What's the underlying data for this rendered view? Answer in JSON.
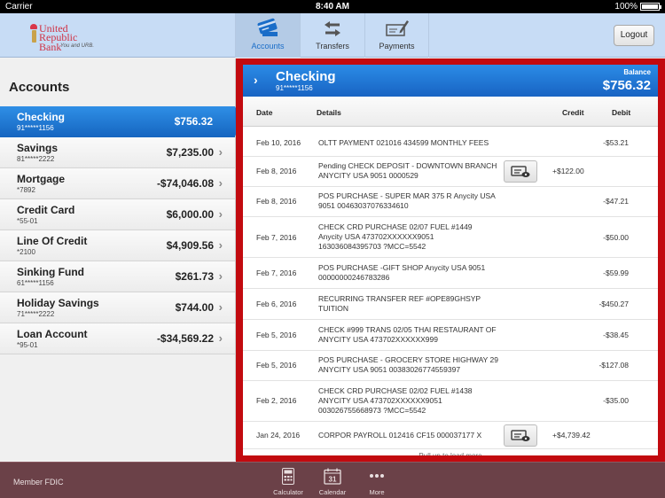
{
  "status_bar": {
    "carrier": "Carrier",
    "time": "8:40 AM",
    "battery": "100%"
  },
  "header": {
    "logo": {
      "line1": "United",
      "line2": "Republic Bank",
      "tagline": "You and URB."
    },
    "tabs": [
      {
        "label": "Accounts",
        "icon": "credit-card-icon",
        "active": true
      },
      {
        "label": "Transfers",
        "icon": "transfer-arrows-icon",
        "active": false
      },
      {
        "label": "Payments",
        "icon": "check-pen-icon",
        "active": false
      }
    ],
    "logout_label": "Logout"
  },
  "sidebar": {
    "title": "Accounts",
    "accounts": [
      {
        "name": "Checking",
        "number": "91*****1156",
        "balance": "$756.32",
        "selected": true
      },
      {
        "name": "Savings",
        "number": "81*****2222",
        "balance": "$7,235.00"
      },
      {
        "name": "Mortgage",
        "number": "*7892",
        "balance": "-$74,046.08"
      },
      {
        "name": "Credit Card",
        "number": "*55-01",
        "balance": "$6,000.00"
      },
      {
        "name": "Line Of Credit",
        "number": "*2100",
        "balance": "$4,909.56"
      },
      {
        "name": "Sinking Fund",
        "number": "61*****1156",
        "balance": "$261.73"
      },
      {
        "name": "Holiday Savings",
        "number": "71*****2222",
        "balance": "$744.00"
      },
      {
        "name": "Loan Account",
        "number": "*95-01",
        "balance": "-$34,569.22"
      }
    ]
  },
  "detail": {
    "account_name": "Checking",
    "account_number": "91*****1156",
    "balance_label": "Balance",
    "balance_value": "$756.32",
    "columns": {
      "date": "Date",
      "details": "Details",
      "credit": "Credit",
      "debit": "Debit"
    },
    "transactions": [
      {
        "date": "Feb 10, 2016",
        "details": "OLTT PAYMENT 021016 434599 MONTHLY FEES",
        "credit": "",
        "debit": "-$53.21",
        "has_image": false
      },
      {
        "date": "Feb 8, 2016",
        "details": "Pending CHECK DEPOSIT - DOWNTOWN BRANCH ANYCITY USA 9051 0000529",
        "credit": "+$122.00",
        "debit": "",
        "has_image": true
      },
      {
        "date": "Feb 8, 2016",
        "details": "POS PURCHASE -  SUPER MAR 375 R Anycity USA 9051 00463037076334610",
        "credit": "",
        "debit": "-$47.21",
        "has_image": false
      },
      {
        "date": "Feb 7, 2016",
        "details": "CHECK CRD PURCHASE 02/07  FUEL #1449 Anycity USA 473702XXXXXX9051 163036084395703 ?MCC=5542",
        "credit": "",
        "debit": "-$50.00",
        "has_image": false
      },
      {
        "date": "Feb 7, 2016",
        "details": "POS PURCHASE -GIFT SHOP Anycity USA 9051 00000000246783286",
        "credit": "",
        "debit": "-$59.99",
        "has_image": false
      },
      {
        "date": "Feb 6, 2016",
        "details": "RECURRING TRANSFER REF #OPE89GHSYP TUITION",
        "credit": "",
        "debit": "-$450.27",
        "has_image": false
      },
      {
        "date": "Feb 5, 2016",
        "details": "CHECK #999 TRANS 02/05 THAI RESTAURANT OF ANYCITY USA 473702XXXXXX999",
        "credit": "",
        "debit": "-$38.45",
        "has_image": false
      },
      {
        "date": "Feb 5, 2016",
        "details": "POS PURCHASE - GROCERY STORE HIGHWAY 29 ANYCITY USA 9051 00383026774559397",
        "credit": "",
        "debit": "-$127.08",
        "has_image": false
      },
      {
        "date": "Feb 2, 2016",
        "details": "CHECK CRD PURCHASE 02/02 FUEL #1438 ANYCITY USA 473702XXXXXX9051 003026755668973 ?MCC=5542",
        "credit": "",
        "debit": "-$35.00",
        "has_image": false
      },
      {
        "date": "Jan 24, 2016",
        "details": "CORPOR PAYROLL 012416 CF15 000037177 X",
        "credit": "+$4,739.42",
        "debit": "",
        "has_image": true
      }
    ],
    "load_more": "Pull up to load more"
  },
  "footer": {
    "fdic": "Member FDIC",
    "tools": [
      {
        "label": "Calculator",
        "icon": "calculator-icon"
      },
      {
        "label": "Calendar",
        "icon": "calendar-icon",
        "day": "31"
      },
      {
        "label": "More",
        "icon": "more-dots-icon"
      }
    ]
  },
  "colors": {
    "brand_red": "#c20a0f",
    "accent_blue": "#1e74cf",
    "header_bg": "#c7dcf5",
    "footer_bg": "#6b4148"
  }
}
